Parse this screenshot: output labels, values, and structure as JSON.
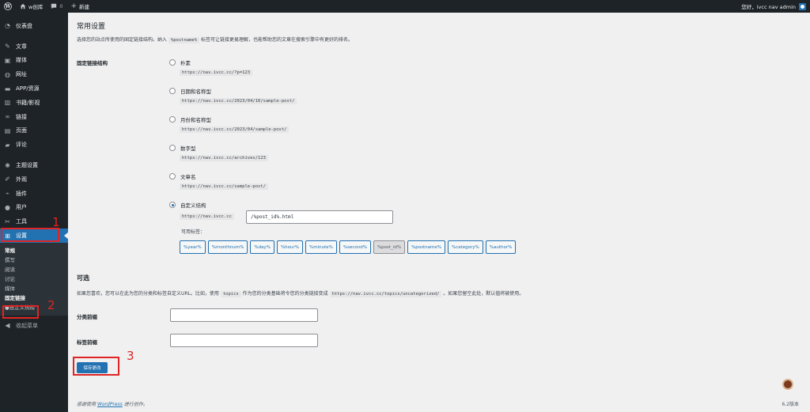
{
  "adminbar": {
    "site_name": "w创库",
    "comments_count": "0",
    "new_label": "新建",
    "greeting": "您好，ivcc nav admin"
  },
  "sidebar": {
    "items": [
      {
        "label": "仪表盘",
        "icon": "dashboard-icon"
      },
      {
        "label": "文章",
        "icon": "pin-icon"
      },
      {
        "label": "媒体",
        "icon": "media-icon"
      },
      {
        "label": "网址",
        "icon": "globe-icon"
      },
      {
        "label": "APP/资源",
        "icon": "app-icon"
      },
      {
        "label": "书籍/影视",
        "icon": "book-icon"
      },
      {
        "label": "链接",
        "icon": "link-icon"
      },
      {
        "label": "页面",
        "icon": "page-icon"
      },
      {
        "label": "评论",
        "icon": "comment-icon"
      },
      {
        "label": "主题设置",
        "icon": "gear-icon"
      },
      {
        "label": "外观",
        "icon": "brush-icon"
      },
      {
        "label": "插件",
        "icon": "plugin-icon"
      },
      {
        "label": "用户",
        "icon": "user-icon"
      },
      {
        "label": "工具",
        "icon": "wrench-icon"
      },
      {
        "label": "设置",
        "icon": "settings-icon"
      }
    ],
    "submenu": [
      "常规",
      "撰写",
      "阅读",
      "讨论",
      "媒体",
      "固定链接",
      "●自定义热榜"
    ],
    "collapse_label": "收起菜单"
  },
  "annotations": [
    "1",
    "2",
    "3"
  ],
  "page": {
    "title": "常用设置",
    "description_pre": "选择您的站点所使用的固定链接结构。纳入",
    "description_code": "%postname%",
    "description_post": "标签可让链接更易理解，也能帮助您的文章在搜索引擎中有更好的排名。",
    "permalink_label": "固定链接结构",
    "options": [
      {
        "label": "朴素",
        "example": "https://nav.ivcc.cc/?p=123"
      },
      {
        "label": "日期和名称型",
        "example": "https://nav.ivcc.cc/2023/04/10/sample-post/"
      },
      {
        "label": "月份和名称型",
        "example": "https://nav.ivcc.cc/2023/04/sample-post/"
      },
      {
        "label": "数字型",
        "example": "https://nav.ivcc.cc/archives/123"
      },
      {
        "label": "文章名",
        "example": "https://nav.ivcc.cc/sample-post/"
      }
    ],
    "custom": {
      "label": "自定义结构",
      "base_url": "https://nav.ivcc.cc",
      "value": "/%post_id%.html",
      "tags_label": "可用标签：",
      "tags": [
        "%year%",
        "%monthnum%",
        "%day%",
        "%hour%",
        "%minute%",
        "%second%",
        "%post_id%",
        "%postname%",
        "%category%",
        "%author%"
      ],
      "active_tag": "%post_id%"
    },
    "optional_title": "可选",
    "optional_desc_pre": "如果您喜欢，您可以在此为您的分类和标签自定义URL。比如，使用",
    "optional_desc_code1": "topics",
    "optional_desc_mid": "作为您的分类基础将令您的分类链接变成",
    "optional_desc_code2": "https://nav.ivcc.cc/topics/uncategorized/",
    "optional_desc_post": "。如果您留空此处，默认值将被使用。",
    "category_base_label": "分类前缀",
    "tag_base_label": "标签前缀",
    "save_label": "保存更改",
    "footer_pre": "感谢使用",
    "footer_link": "WordPress",
    "footer_post": "进行创作。",
    "version": "6.2版本"
  }
}
